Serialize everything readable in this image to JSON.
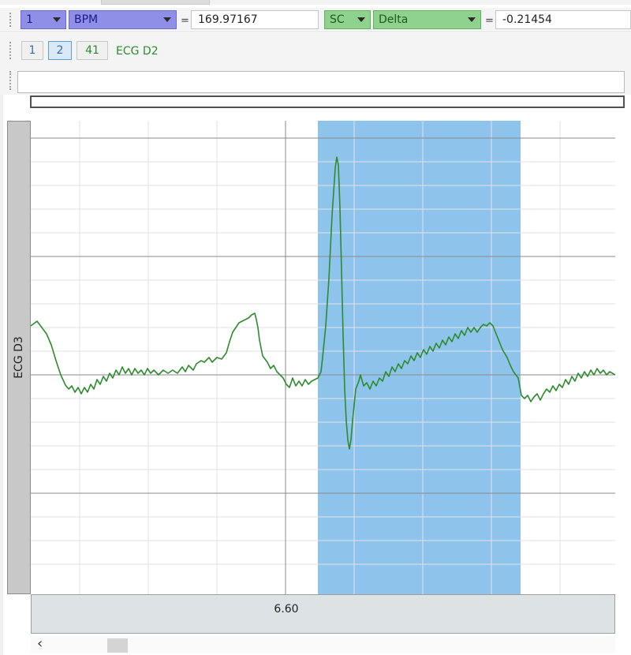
{
  "measurements": [
    {
      "channel": "1",
      "type": "BPM",
      "value": "169.97167"
    },
    {
      "channel": "SC",
      "type": "Delta",
      "value": "-0.21454"
    }
  ],
  "equals": "=",
  "channel_buttons": [
    "1",
    "2",
    "41"
  ],
  "channel_label": "ECG D2",
  "journal_value": "",
  "plot_channel_label": "ECG D3",
  "time_tick": "6.60",
  "scroll_left": "‹",
  "colors": {
    "trace": "#2e8b2e",
    "selection": "#8ec4ec",
    "blue_combo": "#8f8fe8",
    "green_combo": "#8ed28e"
  }
}
